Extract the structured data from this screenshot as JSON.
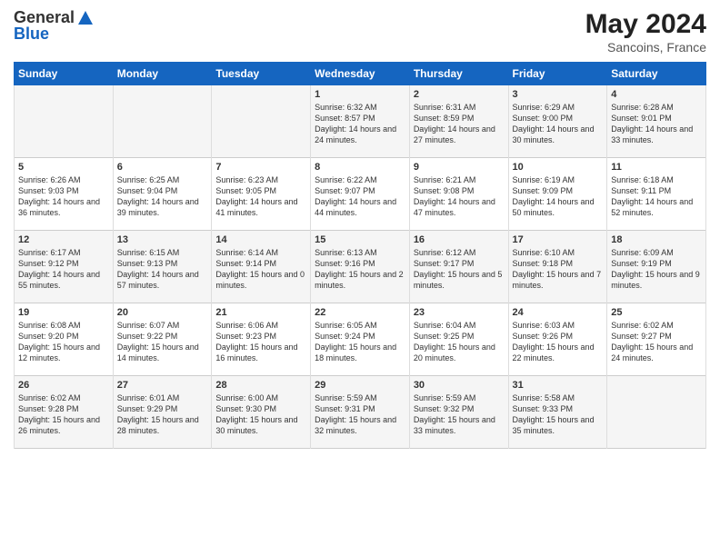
{
  "header": {
    "logo_general": "General",
    "logo_blue": "Blue",
    "month_year": "May 2024",
    "location": "Sancoins, France"
  },
  "days_of_week": [
    "Sunday",
    "Monday",
    "Tuesday",
    "Wednesday",
    "Thursday",
    "Friday",
    "Saturday"
  ],
  "weeks": [
    [
      {
        "day": "",
        "sunrise": "",
        "sunset": "",
        "daylight": ""
      },
      {
        "day": "",
        "sunrise": "",
        "sunset": "",
        "daylight": ""
      },
      {
        "day": "",
        "sunrise": "",
        "sunset": "",
        "daylight": ""
      },
      {
        "day": "1",
        "sunrise": "Sunrise: 6:32 AM",
        "sunset": "Sunset: 8:57 PM",
        "daylight": "Daylight: 14 hours and 24 minutes."
      },
      {
        "day": "2",
        "sunrise": "Sunrise: 6:31 AM",
        "sunset": "Sunset: 8:59 PM",
        "daylight": "Daylight: 14 hours and 27 minutes."
      },
      {
        "day": "3",
        "sunrise": "Sunrise: 6:29 AM",
        "sunset": "Sunset: 9:00 PM",
        "daylight": "Daylight: 14 hours and 30 minutes."
      },
      {
        "day": "4",
        "sunrise": "Sunrise: 6:28 AM",
        "sunset": "Sunset: 9:01 PM",
        "daylight": "Daylight: 14 hours and 33 minutes."
      }
    ],
    [
      {
        "day": "5",
        "sunrise": "Sunrise: 6:26 AM",
        "sunset": "Sunset: 9:03 PM",
        "daylight": "Daylight: 14 hours and 36 minutes."
      },
      {
        "day": "6",
        "sunrise": "Sunrise: 6:25 AM",
        "sunset": "Sunset: 9:04 PM",
        "daylight": "Daylight: 14 hours and 39 minutes."
      },
      {
        "day": "7",
        "sunrise": "Sunrise: 6:23 AM",
        "sunset": "Sunset: 9:05 PM",
        "daylight": "Daylight: 14 hours and 41 minutes."
      },
      {
        "day": "8",
        "sunrise": "Sunrise: 6:22 AM",
        "sunset": "Sunset: 9:07 PM",
        "daylight": "Daylight: 14 hours and 44 minutes."
      },
      {
        "day": "9",
        "sunrise": "Sunrise: 6:21 AM",
        "sunset": "Sunset: 9:08 PM",
        "daylight": "Daylight: 14 hours and 47 minutes."
      },
      {
        "day": "10",
        "sunrise": "Sunrise: 6:19 AM",
        "sunset": "Sunset: 9:09 PM",
        "daylight": "Daylight: 14 hours and 50 minutes."
      },
      {
        "day": "11",
        "sunrise": "Sunrise: 6:18 AM",
        "sunset": "Sunset: 9:11 PM",
        "daylight": "Daylight: 14 hours and 52 minutes."
      }
    ],
    [
      {
        "day": "12",
        "sunrise": "Sunrise: 6:17 AM",
        "sunset": "Sunset: 9:12 PM",
        "daylight": "Daylight: 14 hours and 55 minutes."
      },
      {
        "day": "13",
        "sunrise": "Sunrise: 6:15 AM",
        "sunset": "Sunset: 9:13 PM",
        "daylight": "Daylight: 14 hours and 57 minutes."
      },
      {
        "day": "14",
        "sunrise": "Sunrise: 6:14 AM",
        "sunset": "Sunset: 9:14 PM",
        "daylight": "Daylight: 15 hours and 0 minutes."
      },
      {
        "day": "15",
        "sunrise": "Sunrise: 6:13 AM",
        "sunset": "Sunset: 9:16 PM",
        "daylight": "Daylight: 15 hours and 2 minutes."
      },
      {
        "day": "16",
        "sunrise": "Sunrise: 6:12 AM",
        "sunset": "Sunset: 9:17 PM",
        "daylight": "Daylight: 15 hours and 5 minutes."
      },
      {
        "day": "17",
        "sunrise": "Sunrise: 6:10 AM",
        "sunset": "Sunset: 9:18 PM",
        "daylight": "Daylight: 15 hours and 7 minutes."
      },
      {
        "day": "18",
        "sunrise": "Sunrise: 6:09 AM",
        "sunset": "Sunset: 9:19 PM",
        "daylight": "Daylight: 15 hours and 9 minutes."
      }
    ],
    [
      {
        "day": "19",
        "sunrise": "Sunrise: 6:08 AM",
        "sunset": "Sunset: 9:20 PM",
        "daylight": "Daylight: 15 hours and 12 minutes."
      },
      {
        "day": "20",
        "sunrise": "Sunrise: 6:07 AM",
        "sunset": "Sunset: 9:22 PM",
        "daylight": "Daylight: 15 hours and 14 minutes."
      },
      {
        "day": "21",
        "sunrise": "Sunrise: 6:06 AM",
        "sunset": "Sunset: 9:23 PM",
        "daylight": "Daylight: 15 hours and 16 minutes."
      },
      {
        "day": "22",
        "sunrise": "Sunrise: 6:05 AM",
        "sunset": "Sunset: 9:24 PM",
        "daylight": "Daylight: 15 hours and 18 minutes."
      },
      {
        "day": "23",
        "sunrise": "Sunrise: 6:04 AM",
        "sunset": "Sunset: 9:25 PM",
        "daylight": "Daylight: 15 hours and 20 minutes."
      },
      {
        "day": "24",
        "sunrise": "Sunrise: 6:03 AM",
        "sunset": "Sunset: 9:26 PM",
        "daylight": "Daylight: 15 hours and 22 minutes."
      },
      {
        "day": "25",
        "sunrise": "Sunrise: 6:02 AM",
        "sunset": "Sunset: 9:27 PM",
        "daylight": "Daylight: 15 hours and 24 minutes."
      }
    ],
    [
      {
        "day": "26",
        "sunrise": "Sunrise: 6:02 AM",
        "sunset": "Sunset: 9:28 PM",
        "daylight": "Daylight: 15 hours and 26 minutes."
      },
      {
        "day": "27",
        "sunrise": "Sunrise: 6:01 AM",
        "sunset": "Sunset: 9:29 PM",
        "daylight": "Daylight: 15 hours and 28 minutes."
      },
      {
        "day": "28",
        "sunrise": "Sunrise: 6:00 AM",
        "sunset": "Sunset: 9:30 PM",
        "daylight": "Daylight: 15 hours and 30 minutes."
      },
      {
        "day": "29",
        "sunrise": "Sunrise: 5:59 AM",
        "sunset": "Sunset: 9:31 PM",
        "daylight": "Daylight: 15 hours and 32 minutes."
      },
      {
        "day": "30",
        "sunrise": "Sunrise: 5:59 AM",
        "sunset": "Sunset: 9:32 PM",
        "daylight": "Daylight: 15 hours and 33 minutes."
      },
      {
        "day": "31",
        "sunrise": "Sunrise: 5:58 AM",
        "sunset": "Sunset: 9:33 PM",
        "daylight": "Daylight: 15 hours and 35 minutes."
      },
      {
        "day": "",
        "sunrise": "",
        "sunset": "",
        "daylight": ""
      }
    ]
  ]
}
